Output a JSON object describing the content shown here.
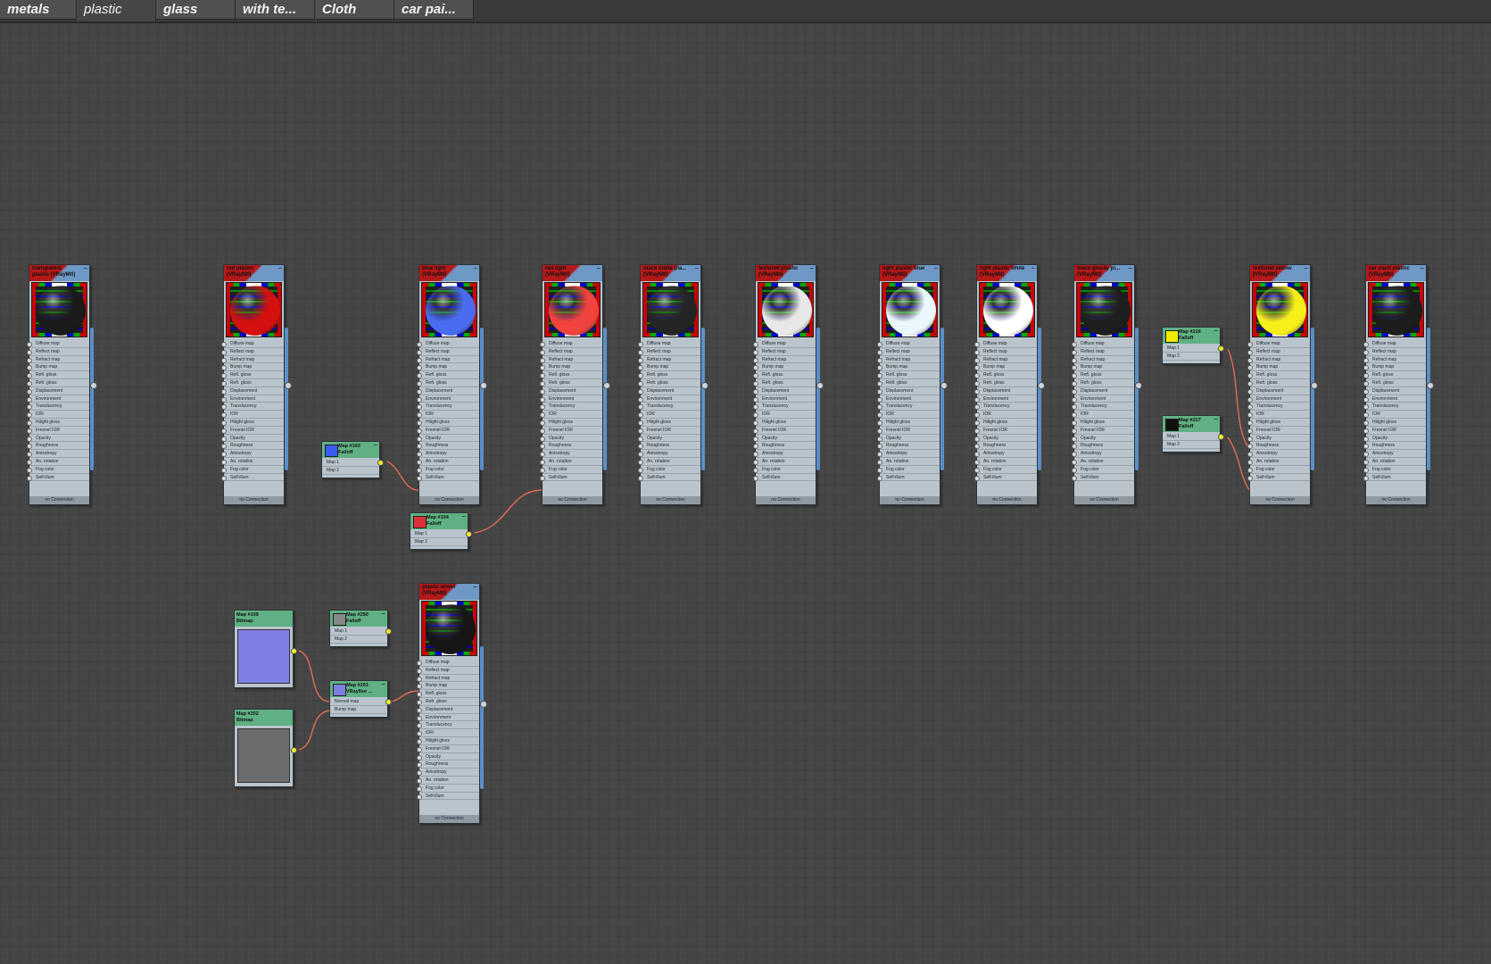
{
  "tabs": [
    {
      "label": "metals",
      "active": false
    },
    {
      "label": "plastic",
      "active": true
    },
    {
      "label": "glass",
      "active": false
    },
    {
      "label": "with te...",
      "active": false
    },
    {
      "label": "Cloth",
      "active": false
    },
    {
      "label": "car pai...",
      "active": false
    }
  ],
  "slot_labels": [
    "Diffuse map",
    "Reflect map",
    "Refract map",
    "Bump map",
    "Refl. gloss",
    "Refr. gloss",
    "Displacement",
    "Environment",
    "Translucency",
    "IOR",
    "Hilight gloss",
    "Fresnel IOR",
    "Opacity",
    "Roughness",
    "Anisotropy",
    "An. rotation",
    "Fog color",
    "Self-illum"
  ],
  "footer_label": "no Connection",
  "materials": [
    {
      "title": "transparent plastic (VRayMtl)",
      "sphere_color": "#1a1a1a"
    },
    {
      "title": "red plastic (VRayMtl)",
      "sphere_color": "#d41010"
    },
    {
      "title": "blue light (VRayMtl)",
      "sphere_color": "#4a6cf0"
    },
    {
      "title": "red light (VRayMtl)",
      "sphere_color": "#f0433e"
    },
    {
      "title": "black matte pla... (VRayMtl)",
      "sphere_color": "#252525"
    },
    {
      "title": "textured plastic (VRayMtl)",
      "sphere_color": "#e8e8e8"
    },
    {
      "title": "light plastic blue (VRayMtl)",
      "sphere_color": "#eaf7fb"
    },
    {
      "title": "light plastic white (VRayMtl)",
      "sphere_color": "#ffffff"
    },
    {
      "title": "black glossy pl... (VRayMtl)",
      "sphere_color": "#1e1e1e"
    },
    {
      "title": "textured yellow (VRayMtl)",
      "sphere_color": "#f7ef1a"
    },
    {
      "title": "car paint plastic (VRayMtl)",
      "sphere_color": "#1c1c1c"
    },
    {
      "title": "plastic wheel (VRayMtl)",
      "sphere_color": "#161616"
    }
  ],
  "maps": [
    {
      "title": "Map #193",
      "subtitle": "Falloff",
      "swatch": "#3a5cf0",
      "slots": [
        "Map 1",
        "Map 2"
      ]
    },
    {
      "title": "Map #194",
      "subtitle": "Falloff",
      "swatch": "#e0303a",
      "slots": [
        "Map 1",
        "Map 2"
      ]
    },
    {
      "title": "Map #216",
      "subtitle": "Falloff",
      "swatch": "#f0ea00",
      "slots": [
        "Map 1",
        "Map 2"
      ]
    },
    {
      "title": "Map #217",
      "subtitle": "Falloff",
      "swatch": "#111111",
      "slots": [
        "Map 1",
        "Map 2"
      ]
    },
    {
      "title": "Map #250",
      "subtitle": "Falloff",
      "swatch": "#888888",
      "slots": [
        "Map 1",
        "Map 2"
      ]
    },
    {
      "title": "Map #203",
      "subtitle": "VRayNor ...",
      "swatch": "#7b7fe0",
      "slots": [
        "Normal map",
        "Bump map"
      ]
    }
  ],
  "bitmaps": [
    {
      "title": "Map #199",
      "subtitle": "Bitmap",
      "preview_color": "#7e7fe1"
    },
    {
      "title": "Map #202",
      "subtitle": "Bitmap",
      "preview_color": "#6c6c6c"
    }
  ],
  "colors": {
    "canvas": "#464646",
    "wire": "#e46a55",
    "material_header": "#b41818",
    "map_header": "#5fb083",
    "node_body": "#b9c4cc"
  }
}
